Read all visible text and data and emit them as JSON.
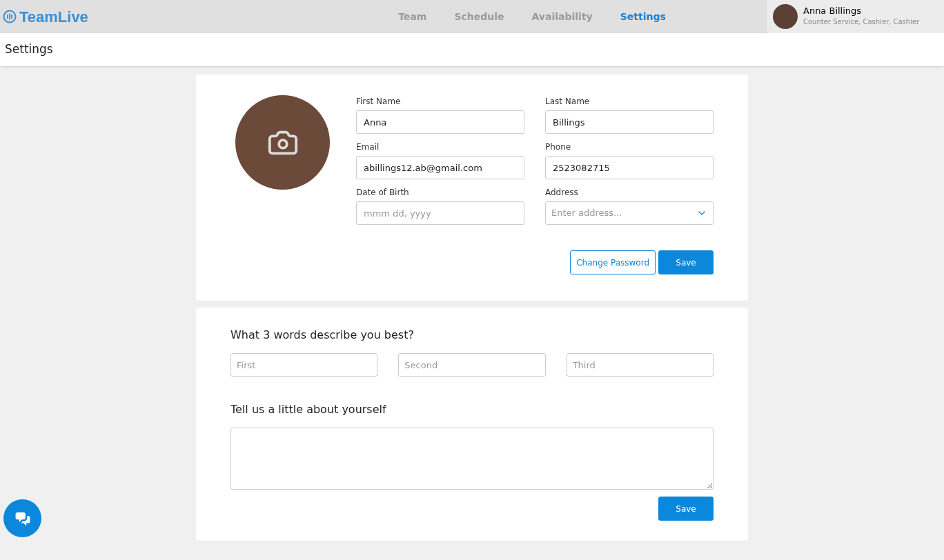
{
  "app": {
    "logo": "TeamLive"
  },
  "nav": [
    {
      "label": "Team",
      "selected": false
    },
    {
      "label": "Schedule",
      "selected": false
    },
    {
      "label": "Availability",
      "selected": false
    },
    {
      "label": "Settings",
      "selected": true
    }
  ],
  "user": {
    "name": "Anna Billings",
    "roles": "Counter Service, Cashier, Cashier"
  },
  "page_title": "Settings",
  "profile": {
    "fields": [
      {
        "label": "First Name",
        "kind": "text",
        "value": "Anna"
      },
      {
        "label": "Last Name",
        "kind": "text",
        "value": "Billings"
      },
      {
        "label": "Email",
        "kind": "text",
        "value": "abillings12.ab@gmail.com"
      },
      {
        "label": "Phone",
        "kind": "text",
        "value": "2523082715"
      },
      {
        "label": "Date of Birth",
        "kind": "text",
        "placeholder": "mmm dd, yyyy"
      },
      {
        "label": "Address",
        "kind": "select",
        "placeholder": "Enter address..."
      }
    ],
    "buttons": [
      {
        "label": "Change Password",
        "kind": "outline"
      },
      {
        "label": "Save",
        "kind": "primary"
      }
    ]
  },
  "about": {
    "words_title": "What 3 words describe you best?",
    "words": [
      {
        "placeholder": "First"
      },
      {
        "placeholder": "Second"
      },
      {
        "placeholder": "Third"
      }
    ],
    "bio_title": "Tell us a little about yourself",
    "save": "Save"
  }
}
